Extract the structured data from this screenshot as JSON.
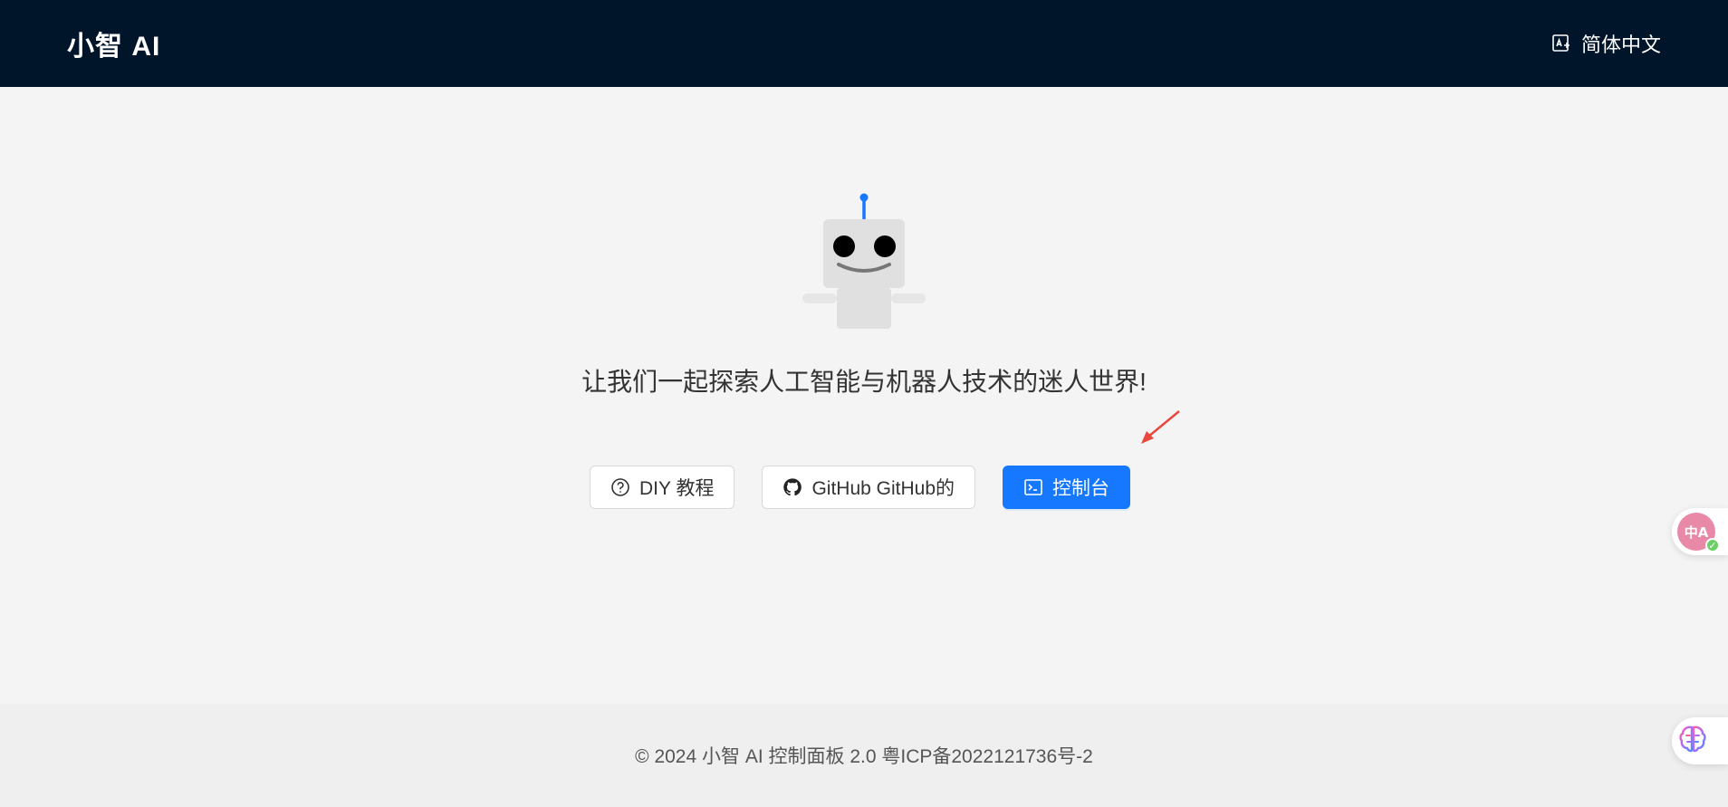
{
  "header": {
    "logo": "小智 AI",
    "language_label": "简体中文"
  },
  "main": {
    "tagline": "让我们一起探索人工智能与机器人技术的迷人世界!",
    "buttons": {
      "diy": "DIY 教程",
      "github": "GitHub  GitHub的",
      "console": "控制台"
    }
  },
  "footer": {
    "text": "© 2024 小智 AI 控制面板 2.0 粤ICP备2022121736号-2"
  },
  "floating": {
    "translate_label": "中A"
  },
  "colors": {
    "header_bg": "#001529",
    "page_bg": "#f4f4f4",
    "primary": "#1677ff",
    "annotation_arrow": "#e8483d"
  },
  "icons": {
    "language": "translate-image-icon",
    "diy": "question-circle-icon",
    "github": "github-icon",
    "console": "terminal-icon",
    "brain": "brain-icon"
  }
}
